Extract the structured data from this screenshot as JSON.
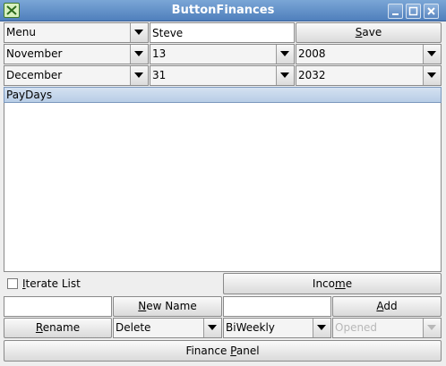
{
  "window": {
    "title": "ButtonFinances"
  },
  "row1": {
    "menu_value": "Menu",
    "name_value": "Steve",
    "save_label": "Save",
    "save_mnemonic": "S"
  },
  "start_date": {
    "month": "November",
    "day": "13",
    "year": "2008"
  },
  "end_date": {
    "month": "December",
    "day": "31",
    "year": "2032"
  },
  "list": {
    "header": "PayDays",
    "items": []
  },
  "controls": {
    "iterate_label": "Iterate List",
    "iterate_mnemonic": "I",
    "income_label": "Income",
    "income_mnemonic": "m",
    "new_name_label": "New Name",
    "new_name_mnemonic": "N",
    "add_label": "Add",
    "add_mnemonic": "A",
    "rename_label": "Rename",
    "rename_mnemonic": "R",
    "delete_value": "Delete",
    "frequency_value": "BiWeekly",
    "status_value": "Opened",
    "finance_panel_label": "Finance Panel",
    "finance_panel_mnemonic": "P"
  },
  "icons": {
    "app": "app-icon",
    "minimize": "minimize-icon",
    "maximize": "maximize-icon",
    "close": "close-icon",
    "dropdown": "chevron-down-icon"
  },
  "colors": {
    "titlebar": "#5f8fc8",
    "list_header": "#c6d7ec",
    "panel": "#eeeeee"
  }
}
